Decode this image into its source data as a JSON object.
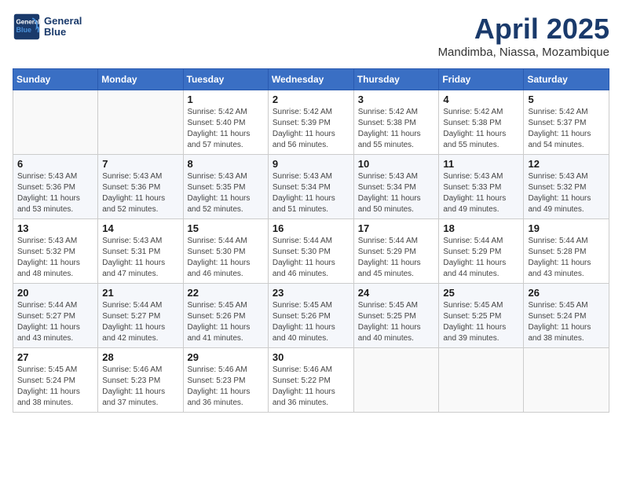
{
  "header": {
    "logo_line1": "General",
    "logo_line2": "Blue",
    "month": "April 2025",
    "location": "Mandimba, Niassa, Mozambique"
  },
  "weekdays": [
    "Sunday",
    "Monday",
    "Tuesday",
    "Wednesday",
    "Thursday",
    "Friday",
    "Saturday"
  ],
  "weeks": [
    [
      {
        "day": "",
        "sunrise": "",
        "sunset": "",
        "daylight": ""
      },
      {
        "day": "",
        "sunrise": "",
        "sunset": "",
        "daylight": ""
      },
      {
        "day": "1",
        "sunrise": "Sunrise: 5:42 AM",
        "sunset": "Sunset: 5:40 PM",
        "daylight": "Daylight: 11 hours and 57 minutes."
      },
      {
        "day": "2",
        "sunrise": "Sunrise: 5:42 AM",
        "sunset": "Sunset: 5:39 PM",
        "daylight": "Daylight: 11 hours and 56 minutes."
      },
      {
        "day": "3",
        "sunrise": "Sunrise: 5:42 AM",
        "sunset": "Sunset: 5:38 PM",
        "daylight": "Daylight: 11 hours and 55 minutes."
      },
      {
        "day": "4",
        "sunrise": "Sunrise: 5:42 AM",
        "sunset": "Sunset: 5:38 PM",
        "daylight": "Daylight: 11 hours and 55 minutes."
      },
      {
        "day": "5",
        "sunrise": "Sunrise: 5:42 AM",
        "sunset": "Sunset: 5:37 PM",
        "daylight": "Daylight: 11 hours and 54 minutes."
      }
    ],
    [
      {
        "day": "6",
        "sunrise": "Sunrise: 5:43 AM",
        "sunset": "Sunset: 5:36 PM",
        "daylight": "Daylight: 11 hours and 53 minutes."
      },
      {
        "day": "7",
        "sunrise": "Sunrise: 5:43 AM",
        "sunset": "Sunset: 5:36 PM",
        "daylight": "Daylight: 11 hours and 52 minutes."
      },
      {
        "day": "8",
        "sunrise": "Sunrise: 5:43 AM",
        "sunset": "Sunset: 5:35 PM",
        "daylight": "Daylight: 11 hours and 52 minutes."
      },
      {
        "day": "9",
        "sunrise": "Sunrise: 5:43 AM",
        "sunset": "Sunset: 5:34 PM",
        "daylight": "Daylight: 11 hours and 51 minutes."
      },
      {
        "day": "10",
        "sunrise": "Sunrise: 5:43 AM",
        "sunset": "Sunset: 5:34 PM",
        "daylight": "Daylight: 11 hours and 50 minutes."
      },
      {
        "day": "11",
        "sunrise": "Sunrise: 5:43 AM",
        "sunset": "Sunset: 5:33 PM",
        "daylight": "Daylight: 11 hours and 49 minutes."
      },
      {
        "day": "12",
        "sunrise": "Sunrise: 5:43 AM",
        "sunset": "Sunset: 5:32 PM",
        "daylight": "Daylight: 11 hours and 49 minutes."
      }
    ],
    [
      {
        "day": "13",
        "sunrise": "Sunrise: 5:43 AM",
        "sunset": "Sunset: 5:32 PM",
        "daylight": "Daylight: 11 hours and 48 minutes."
      },
      {
        "day": "14",
        "sunrise": "Sunrise: 5:43 AM",
        "sunset": "Sunset: 5:31 PM",
        "daylight": "Daylight: 11 hours and 47 minutes."
      },
      {
        "day": "15",
        "sunrise": "Sunrise: 5:44 AM",
        "sunset": "Sunset: 5:30 PM",
        "daylight": "Daylight: 11 hours and 46 minutes."
      },
      {
        "day": "16",
        "sunrise": "Sunrise: 5:44 AM",
        "sunset": "Sunset: 5:30 PM",
        "daylight": "Daylight: 11 hours and 46 minutes."
      },
      {
        "day": "17",
        "sunrise": "Sunrise: 5:44 AM",
        "sunset": "Sunset: 5:29 PM",
        "daylight": "Daylight: 11 hours and 45 minutes."
      },
      {
        "day": "18",
        "sunrise": "Sunrise: 5:44 AM",
        "sunset": "Sunset: 5:29 PM",
        "daylight": "Daylight: 11 hours and 44 minutes."
      },
      {
        "day": "19",
        "sunrise": "Sunrise: 5:44 AM",
        "sunset": "Sunset: 5:28 PM",
        "daylight": "Daylight: 11 hours and 43 minutes."
      }
    ],
    [
      {
        "day": "20",
        "sunrise": "Sunrise: 5:44 AM",
        "sunset": "Sunset: 5:27 PM",
        "daylight": "Daylight: 11 hours and 43 minutes."
      },
      {
        "day": "21",
        "sunrise": "Sunrise: 5:44 AM",
        "sunset": "Sunset: 5:27 PM",
        "daylight": "Daylight: 11 hours and 42 minutes."
      },
      {
        "day": "22",
        "sunrise": "Sunrise: 5:45 AM",
        "sunset": "Sunset: 5:26 PM",
        "daylight": "Daylight: 11 hours and 41 minutes."
      },
      {
        "day": "23",
        "sunrise": "Sunrise: 5:45 AM",
        "sunset": "Sunset: 5:26 PM",
        "daylight": "Daylight: 11 hours and 40 minutes."
      },
      {
        "day": "24",
        "sunrise": "Sunrise: 5:45 AM",
        "sunset": "Sunset: 5:25 PM",
        "daylight": "Daylight: 11 hours and 40 minutes."
      },
      {
        "day": "25",
        "sunrise": "Sunrise: 5:45 AM",
        "sunset": "Sunset: 5:25 PM",
        "daylight": "Daylight: 11 hours and 39 minutes."
      },
      {
        "day": "26",
        "sunrise": "Sunrise: 5:45 AM",
        "sunset": "Sunset: 5:24 PM",
        "daylight": "Daylight: 11 hours and 38 minutes."
      }
    ],
    [
      {
        "day": "27",
        "sunrise": "Sunrise: 5:45 AM",
        "sunset": "Sunset: 5:24 PM",
        "daylight": "Daylight: 11 hours and 38 minutes."
      },
      {
        "day": "28",
        "sunrise": "Sunrise: 5:46 AM",
        "sunset": "Sunset: 5:23 PM",
        "daylight": "Daylight: 11 hours and 37 minutes."
      },
      {
        "day": "29",
        "sunrise": "Sunrise: 5:46 AM",
        "sunset": "Sunset: 5:23 PM",
        "daylight": "Daylight: 11 hours and 36 minutes."
      },
      {
        "day": "30",
        "sunrise": "Sunrise: 5:46 AM",
        "sunset": "Sunset: 5:22 PM",
        "daylight": "Daylight: 11 hours and 36 minutes."
      },
      {
        "day": "",
        "sunrise": "",
        "sunset": "",
        "daylight": ""
      },
      {
        "day": "",
        "sunrise": "",
        "sunset": "",
        "daylight": ""
      },
      {
        "day": "",
        "sunrise": "",
        "sunset": "",
        "daylight": ""
      }
    ]
  ]
}
